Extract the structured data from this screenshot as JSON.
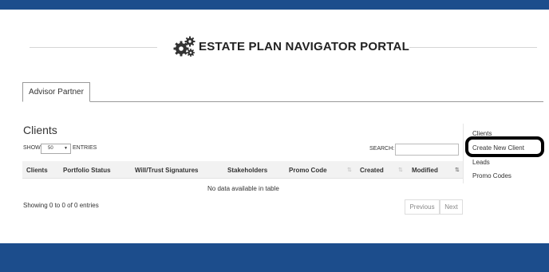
{
  "header": {
    "title": "ESTATE PLAN NAVIGATOR PORTAL",
    "icon": "gears-icon"
  },
  "tabs": [
    {
      "label": "Advisor Partner",
      "active": true
    }
  ],
  "main": {
    "title": "Clients",
    "show_label": "SHOW",
    "entries_value": "50",
    "entries_label": "ENTRIES",
    "search_label": "SEARCH:",
    "search_value": "",
    "columns": [
      "Clients",
      "Portfolio Status",
      "Will/Trust Signatures",
      "Stakeholders",
      "Promo Code",
      "Created",
      "Modified"
    ],
    "empty_message": "No data available in table",
    "info": "Showing 0 to 0 of 0 entries",
    "pagination": {
      "previous": "Previous",
      "next": "Next"
    }
  },
  "sidebar": {
    "items": [
      "Clients",
      "Create New Client",
      "Leads",
      "Promo Codes"
    ],
    "highlighted_item": "Create New Client"
  },
  "colors": {
    "brand_blue": "#1c4d8c",
    "highlight_ring": "#000000"
  }
}
